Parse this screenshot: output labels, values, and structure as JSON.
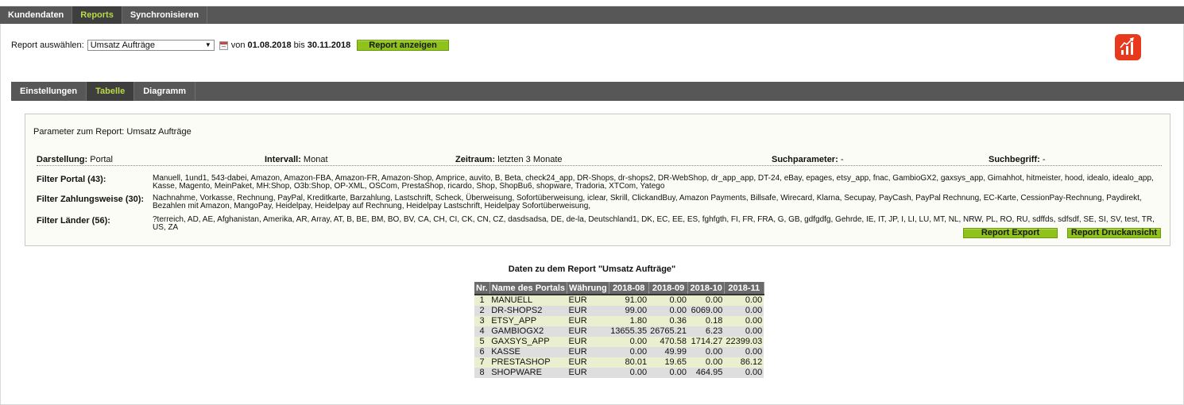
{
  "top_nav": {
    "tabs": [
      "Kundendaten",
      "Reports",
      "Synchronisieren"
    ],
    "active_index": 1
  },
  "controls": {
    "label": "Report auswählen:",
    "selected_report": "Umsatz Aufträge",
    "from_prefix": "von",
    "from_date": "01.08.2018",
    "to_prefix": "bis",
    "to_date": "30.11.2018",
    "show_button": "Report anzeigen"
  },
  "app_icon": "chart-bars-icon",
  "sub_nav": {
    "tabs": [
      "Einstellungen",
      "Tabelle",
      "Diagramm"
    ],
    "active_index": 1
  },
  "params": {
    "title": "Parameter zum Report: Umsatz Aufträge",
    "darstellung_label": "Darstellung:",
    "darstellung_value": "Portal",
    "intervall_label": "Intervall:",
    "intervall_value": "Monat",
    "zeitraum_label": "Zeitraum:",
    "zeitraum_value": "letzten 3 Monate",
    "suchparameter_label": "Suchparameter:",
    "suchparameter_value": "-",
    "suchbegriff_label": "Suchbegriff:",
    "suchbegriff_value": "-",
    "filter_portal_label": "Filter Portal (43):",
    "filter_portal_value": "Manuell, 1und1, 543-dabei, Amazon, Amazon-FBA, Amazon-FR, Amazon-Shop, Amprice, auvito, B, Beta, check24_app, DR-Shops, dr-shops2, DR-WebShop, dr_app_app, DT-24, eBay, epages, etsy_app, fnac, GambioGX2, gaxsys_app, Gimahhot, hitmeister, hood, idealo, idealo_app, Kasse, Magento, MeinPaket, MH:Shop, O3b:Shop, OP-XML, OSCom, PrestaShop, ricardo, Shop, ShopBu6, shopware, Tradoria, XTCom, Yatego",
    "filter_zahlung_label": "Filter Zahlungsweise (30):",
    "filter_zahlung_value": "Nachnahme, Vorkasse, Rechnung, PayPal, Kreditkarte, Barzahlung, Lastschrift, Scheck, Überweisung, Sofortüberweisung, iclear, Skrill, ClickandBuy, Amazon Payments, Billsafe, Wirecard, Klarna, Secupay, PayCash, PayPal Rechnung, EC-Karte, CessionPay-Rechnung, Paydirekt, Bezahlen mit Amazon, MangoPay, Heidelpay, Heidelpay auf Rechnung, Heidelpay Lastschrift, Heidelpay Sofortüberweisung,",
    "filter_laender_label": "Filter Länder (56):",
    "filter_laender_value": "?terreich, AD, AE, Afghanistan, Amerika, AR, Array, AT, B, BE, BM, BO, BV, CA, CH, CI, CK, CN, CZ, dasdsadsa, DE, de-la, Deutschland1, DK, EC, EE, ES, fghfgth, FI, FR, FRA, G, GB, gdfgdfg, Gehrde, IE, IT, JP, I, LI, LU, MT, NL, NRW, PL, RO, RU, sdffds, sdfsdf, SE, SI, SV, test, TR, US, ZA",
    "export_button": "Report Export",
    "print_button": "Report Druckansicht"
  },
  "report": {
    "title": "Daten zu dem Report \"Umsatz Aufträge\"",
    "headers": [
      "Nr.",
      "Name des Portals",
      "Währung",
      "2018-08",
      "2018-09",
      "2018-10",
      "2018-11"
    ],
    "rows": [
      [
        "1",
        "MANUELL",
        "EUR",
        "91.00",
        "0.00",
        "0.00",
        "0.00"
      ],
      [
        "2",
        "DR-SHOPS2",
        "EUR",
        "99.00",
        "0.00",
        "6069.00",
        "0.00"
      ],
      [
        "3",
        "ETSY_APP",
        "EUR",
        "1.80",
        "0.36",
        "0.18",
        "0.00"
      ],
      [
        "4",
        "GAMBIOGX2",
        "EUR",
        "13655.35",
        "26765.21",
        "6.23",
        "0.00"
      ],
      [
        "5",
        "GAXSYS_APP",
        "EUR",
        "0.00",
        "470.58",
        "1714.27",
        "22399.03"
      ],
      [
        "6",
        "KASSE",
        "EUR",
        "0.00",
        "49.99",
        "0.00",
        "0.00"
      ],
      [
        "7",
        "PRESTASHOP",
        "EUR",
        "80.01",
        "19.65",
        "0.00",
        "86.12"
      ],
      [
        "8",
        "SHOPWARE",
        "EUR",
        "0.00",
        "0.00",
        "464.95",
        "0.00"
      ]
    ]
  }
}
